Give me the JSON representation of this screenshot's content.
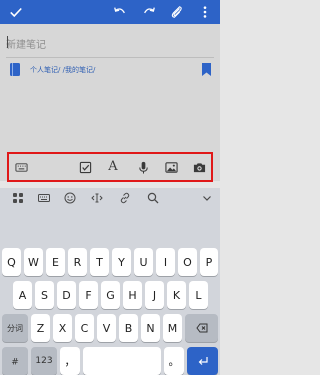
{
  "editor": {
    "title_placeholder": "新建笔记",
    "notebook_path": "个人笔记/ /我的笔记/"
  },
  "keyboard": {
    "row1": [
      "Q",
      "W",
      "E",
      "R",
      "T",
      "Y",
      "U",
      "I",
      "O",
      "P"
    ],
    "row2": [
      "A",
      "S",
      "D",
      "F",
      "G",
      "H",
      "J",
      "K",
      "L"
    ],
    "row3": [
      "Z",
      "X",
      "C",
      "V",
      "B",
      "N",
      "M"
    ],
    "left_fn": "分词",
    "numbers": "123",
    "punct": "，",
    "space": "",
    "period": "。"
  },
  "colors": {
    "accent": "#2d63c7",
    "highlight_box": "#e01818"
  }
}
